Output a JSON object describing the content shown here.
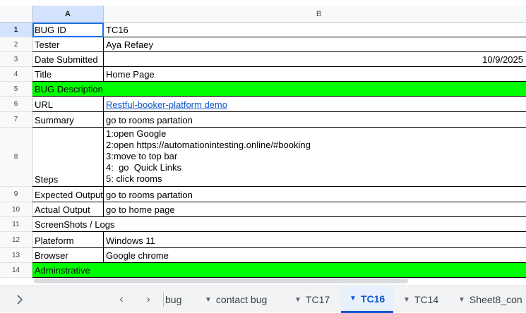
{
  "columns": {
    "a": "A",
    "b": "B"
  },
  "rows": [
    {
      "num": "1",
      "label": "BUG ID",
      "value": "TC16"
    },
    {
      "num": "2",
      "label": "Tester",
      "value": "Aya Refaey"
    },
    {
      "num": "3",
      "label": "Date Submitted",
      "value": "10/9/2025"
    },
    {
      "num": "4",
      "label": "Title",
      "value": "Home Page"
    },
    {
      "num": "5",
      "label": "BUG Description",
      "value": ""
    },
    {
      "num": "6",
      "label": "URL",
      "value": "Restful-booker-platform demo"
    },
    {
      "num": "7",
      "label": "Summary",
      "value": "go to rooms partation"
    },
    {
      "num": "8",
      "label": "Steps",
      "value": "",
      "steps": [
        "1:open Google",
        "2:open https://automationintesting.online/#booking",
        "3:move to top bar",
        "4:  go  Quick Links",
        "5: click rooms"
      ]
    },
    {
      "num": "9",
      "label": "Expected Output",
      "value": "go to rooms partation"
    },
    {
      "num": "10",
      "label": "Actual Output",
      "value": "go to home page"
    },
    {
      "num": "11",
      "label": "ScreenShots / Logs",
      "value": ""
    },
    {
      "num": "12",
      "label": "Plateform",
      "value": "Windows 11"
    },
    {
      "num": "13",
      "label": "Browser",
      "value": "Google chrome"
    },
    {
      "num": "14",
      "label": "Adminstrative",
      "value": ""
    }
  ],
  "colors": {
    "highlight": "#00ff00",
    "link": "#1155cc",
    "active_tab": "#0b57d0"
  },
  "tabs": {
    "expand_icon": "chevron-right-icon",
    "prev": "‹",
    "next": "›",
    "items": [
      "bug",
      "contact bug",
      "TC17",
      "TC16",
      "TC14",
      "Sheet8_con"
    ],
    "active": "TC16"
  }
}
